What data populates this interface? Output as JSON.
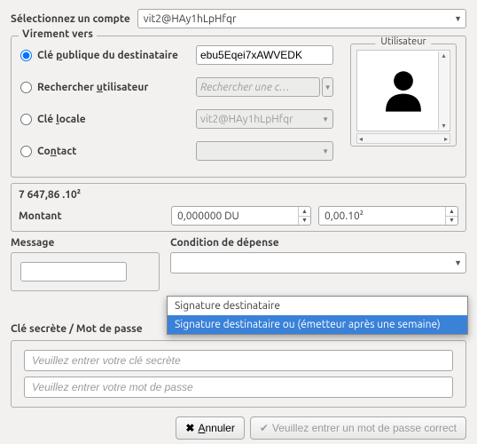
{
  "header": {
    "select_account_label": "Sélectionnez un compte",
    "selected_account": "vit2@HAy1hLpHfqr"
  },
  "transfer": {
    "legend": "Virement vers",
    "options": {
      "recipient_pubkey_label_pre": "Clé ",
      "recipient_pubkey_label_u": "p",
      "recipient_pubkey_label_post": "ublique du destinataire",
      "recipient_pubkey_value": "ebu5Eqei7xAWVEDK",
      "search_user_label_pre": "Rechercher ",
      "search_user_label_u": "u",
      "search_user_label_post": "tilisateur",
      "search_user_placeholder": "Rechercher une c…",
      "local_key_label_pre": "Clé ",
      "local_key_label_u": "l",
      "local_key_label_post": "ocale",
      "local_key_value": "vit2@HAy1hLpHfqr",
      "contact_label_pre": "Co",
      "contact_label_u": "n",
      "contact_label_post": "tact",
      "contact_value": ""
    },
    "user_box_title": "Utilisateur"
  },
  "amount": {
    "available": "7 647,86 .10²",
    "label": "Montant",
    "value_du": "0,000000 DU",
    "value_exp": "0,00.10²"
  },
  "message": {
    "label": "Message",
    "value": ""
  },
  "condition": {
    "label": "Condition de dépense",
    "options": [
      "Signature destinataire",
      "Signature destinataire ou (émetteur après une semaine)"
    ]
  },
  "secret": {
    "label": "Clé secrète / Mot de passe",
    "key_placeholder": "Veuillez entrer votre clé secrète",
    "password_placeholder": "Veuillez entrer votre mot de passe"
  },
  "footer": {
    "cancel_label_u": "A",
    "cancel_label_post": "nnuler",
    "submit_label": "Veuillez entrer un mot de passe correct"
  }
}
